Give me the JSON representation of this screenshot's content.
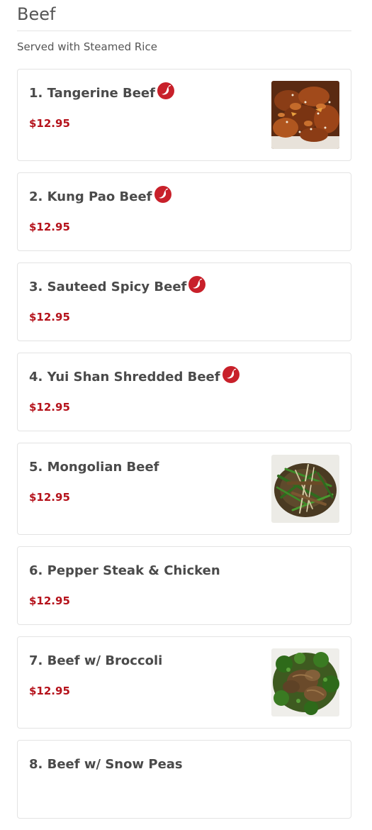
{
  "section": {
    "title": "Beef",
    "subtitle": "Served with Steamed Rice"
  },
  "colors": {
    "price": "#b5121b",
    "spicy_icon": "#c8202a",
    "title": "#555555",
    "border": "#e3e3e3"
  },
  "items": [
    {
      "name": "1. Tangerine Beef",
      "price": "$12.95",
      "spicy": true,
      "spicy_icon": "chili-pepper-icon",
      "has_image": true
    },
    {
      "name": "2. Kung Pao Beef",
      "price": "$12.95",
      "spicy": true,
      "spicy_icon": "chili-pepper-icon",
      "has_image": false
    },
    {
      "name": "3. Sauteed Spicy Beef",
      "price": "$12.95",
      "spicy": true,
      "spicy_icon": "chili-pepper-icon",
      "has_image": false
    },
    {
      "name": "4. Yui Shan Shredded Beef",
      "price": "$12.95",
      "spicy": true,
      "spicy_icon": "chili-pepper-icon",
      "has_image": false
    },
    {
      "name": "5. Mongolian Beef",
      "price": "$12.95",
      "spicy": false,
      "has_image": true
    },
    {
      "name": "6. Pepper Steak & Chicken",
      "price": "$12.95",
      "spicy": false,
      "has_image": false
    },
    {
      "name": "7. Beef w/ Broccoli",
      "price": "$12.95",
      "spicy": false,
      "has_image": true
    },
    {
      "name": "8. Beef w/ Snow Peas",
      "price": "",
      "spicy": false,
      "has_image": false
    }
  ]
}
